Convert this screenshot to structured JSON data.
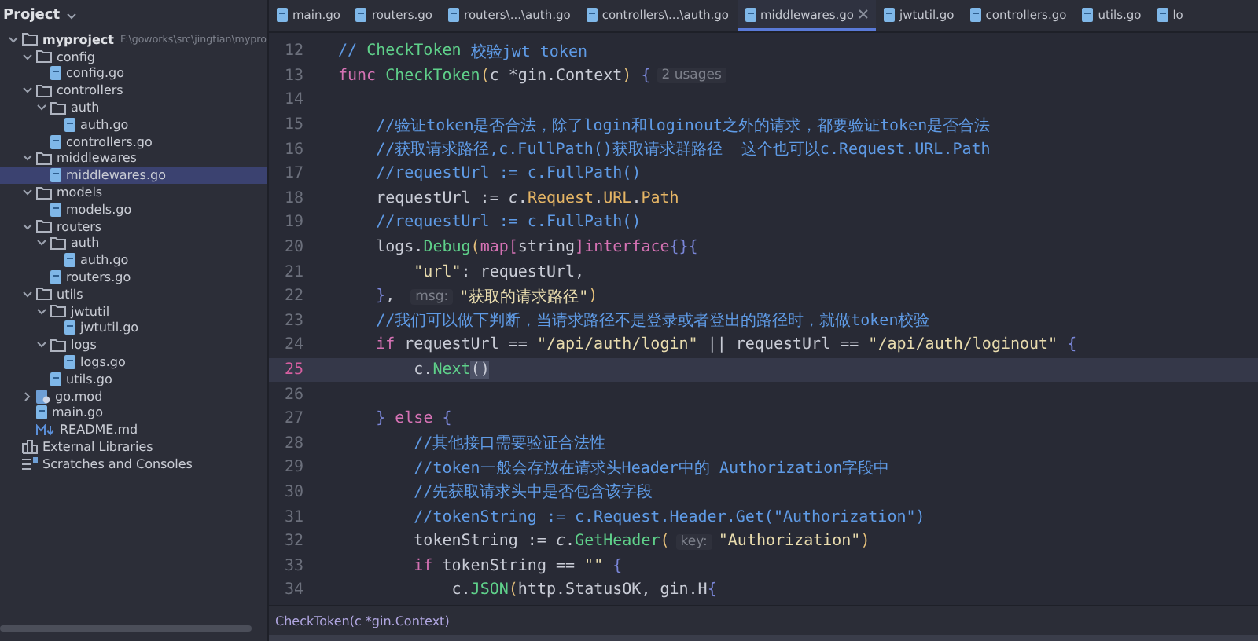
{
  "sidebar": {
    "title": "Project",
    "tree": [
      {
        "label": "myproject",
        "path": "F:\\goworks\\src\\jingtian\\mypro",
        "kind": "folder",
        "expanded": true,
        "selected": false,
        "children": [
          {
            "label": "config",
            "kind": "folder",
            "expanded": true,
            "selected": false,
            "children": [
              {
                "label": "config.go",
                "kind": "go",
                "selected": false
              }
            ]
          },
          {
            "label": "controllers",
            "kind": "folder",
            "expanded": true,
            "selected": false,
            "children": [
              {
                "label": "auth",
                "kind": "folder",
                "expanded": true,
                "selected": false,
                "children": [
                  {
                    "label": "auth.go",
                    "kind": "go",
                    "selected": false
                  }
                ]
              },
              {
                "label": "controllers.go",
                "kind": "go",
                "selected": false
              }
            ]
          },
          {
            "label": "middlewares",
            "kind": "folder",
            "expanded": true,
            "selected": false,
            "children": [
              {
                "label": "middlewares.go",
                "kind": "go",
                "selected": true
              }
            ]
          },
          {
            "label": "models",
            "kind": "folder",
            "expanded": true,
            "selected": false,
            "children": [
              {
                "label": "models.go",
                "kind": "go",
                "selected": false
              }
            ]
          },
          {
            "label": "routers",
            "kind": "folder",
            "expanded": true,
            "selected": false,
            "children": [
              {
                "label": "auth",
                "kind": "folder",
                "expanded": true,
                "selected": false,
                "children": [
                  {
                    "label": "auth.go",
                    "kind": "go",
                    "selected": false
                  }
                ]
              },
              {
                "label": "routers.go",
                "kind": "go",
                "selected": false
              }
            ]
          },
          {
            "label": "utils",
            "kind": "folder",
            "expanded": true,
            "selected": false,
            "children": [
              {
                "label": "jwtutil",
                "kind": "folder",
                "expanded": true,
                "selected": false,
                "children": [
                  {
                    "label": "jwtutil.go",
                    "kind": "go",
                    "selected": false
                  }
                ]
              },
              {
                "label": "logs",
                "kind": "folder",
                "expanded": true,
                "selected": false,
                "children": [
                  {
                    "label": "logs.go",
                    "kind": "go",
                    "selected": false
                  }
                ]
              },
              {
                "label": "utils.go",
                "kind": "go",
                "selected": false
              }
            ]
          },
          {
            "label": "go.mod",
            "kind": "mod",
            "expanded": false,
            "selected": false
          },
          {
            "label": "main.go",
            "kind": "go",
            "selected": false
          },
          {
            "label": "README.md",
            "kind": "md",
            "selected": false
          }
        ]
      },
      {
        "label": "External Libraries",
        "kind": "libraries",
        "selected": false
      },
      {
        "label": "Scratches and Consoles",
        "kind": "scratches",
        "selected": false
      }
    ]
  },
  "tabs": [
    {
      "label": "main.go",
      "selected": false
    },
    {
      "label": "routers.go",
      "selected": false
    },
    {
      "label": "routers\\...\\auth.go",
      "selected": false
    },
    {
      "label": "controllers\\...\\auth.go",
      "selected": false
    },
    {
      "label": "middlewares.go",
      "selected": true
    },
    {
      "label": "jwtutil.go",
      "selected": false
    },
    {
      "label": "controllers.go",
      "selected": false
    },
    {
      "label": "utils.go",
      "selected": false
    },
    {
      "label": "lo",
      "selected": false
    }
  ],
  "editor": {
    "lines": [
      {
        "number": "12",
        "current": false,
        "tokens": [
          {
            "kind": "comment",
            "text": "// "
          },
          {
            "kind": "commentref",
            "text": "CheckToken"
          },
          {
            "kind": "comment",
            "text": " 校验jwt token"
          }
        ]
      },
      {
        "number": "13",
        "current": false,
        "tokens": [
          {
            "kind": "keyword",
            "text": "func "
          },
          {
            "kind": "func",
            "text": "CheckToken"
          },
          {
            "kind": "paren",
            "text": "("
          },
          {
            "kind": "plain",
            "text": "c *gin.Context"
          },
          {
            "kind": "paren",
            "text": ")"
          },
          {
            "kind": "brace",
            "text": " {"
          },
          {
            "kind": "hint",
            "text": "2 usages"
          }
        ]
      },
      {
        "number": "14",
        "current": false
      },
      {
        "number": "15",
        "current": false,
        "tokens": [
          {
            "kind": "comment",
            "text": "    //验证token是否合法，除了login和loginout之外的请求，都要验证token是否合法"
          }
        ]
      },
      {
        "number": "16",
        "current": false,
        "tokens": [
          {
            "kind": "comment",
            "text": "    //获取请求路径,c.FullPath()获取请求群路径  这个也可以c.Request.URL.Path"
          }
        ]
      },
      {
        "number": "17",
        "current": false,
        "tokens": [
          {
            "kind": "comment",
            "text": "    //requestUrl := c.FullPath()"
          }
        ]
      },
      {
        "number": "18",
        "current": false,
        "tokens": [
          {
            "kind": "plain",
            "text": "    requestUrl := "
          },
          {
            "kind": "receiver",
            "text": "c"
          },
          {
            "kind": "plain",
            "text": "."
          },
          {
            "kind": "field",
            "text": "Request"
          },
          {
            "kind": "plain",
            "text": "."
          },
          {
            "kind": "field",
            "text": "URL"
          },
          {
            "kind": "plain",
            "text": "."
          },
          {
            "kind": "field",
            "text": "Path"
          }
        ]
      },
      {
        "number": "19",
        "current": false,
        "tokens": [
          {
            "kind": "comment",
            "text": "    //requestUrl := c.FullPath()"
          }
        ]
      },
      {
        "number": "20",
        "current": false,
        "tokens": [
          {
            "kind": "plain",
            "text": "    logs."
          },
          {
            "kind": "func",
            "text": "Debug"
          },
          {
            "kind": "paren",
            "text": "("
          },
          {
            "kind": "keyword",
            "text": "map"
          },
          {
            "kind": "bracket",
            "text": "["
          },
          {
            "kind": "plain",
            "text": "string"
          },
          {
            "kind": "bracket",
            "text": "]"
          },
          {
            "kind": "keyword",
            "text": "interface"
          },
          {
            "kind": "brace",
            "text": "{}{"
          }
        ]
      },
      {
        "number": "21",
        "current": false,
        "tokens": [
          {
            "kind": "string",
            "text": "        \"url\""
          },
          {
            "kind": "plain",
            "text": ": requestUrl,"
          }
        ]
      },
      {
        "number": "22",
        "current": false,
        "tokens": [
          {
            "kind": "brace",
            "text": "    }"
          },
          {
            "kind": "plain",
            "text": ", "
          },
          {
            "kind": "hint",
            "text": "msg:"
          },
          {
            "kind": "string",
            "text": "\"获取的请求路径\""
          },
          {
            "kind": "paren",
            "text": ")"
          }
        ]
      },
      {
        "number": "23",
        "current": false,
        "tokens": [
          {
            "kind": "comment",
            "text": "    //我们可以做下判断，当请求路径不是登录或者登出的路径时，就做token校验"
          }
        ]
      },
      {
        "number": "24",
        "current": false,
        "tokens": [
          {
            "kind": "keyword",
            "text": "    if"
          },
          {
            "kind": "plain",
            "text": " requestUrl == "
          },
          {
            "kind": "string",
            "text": "\"/api/auth/login\""
          },
          {
            "kind": "plain",
            "text": " || requestUrl == "
          },
          {
            "kind": "string",
            "text": "\"/api/auth/loginout\""
          },
          {
            "kind": "brace",
            "text": " {"
          }
        ]
      },
      {
        "number": "25",
        "current": true,
        "tokens": [
          {
            "kind": "plain",
            "text": "        c."
          },
          {
            "kind": "func",
            "text": "Next"
          },
          {
            "kind": "matched",
            "text": "()"
          }
        ]
      },
      {
        "number": "26",
        "current": false
      },
      {
        "number": "27",
        "current": false,
        "tokens": [
          {
            "kind": "brace",
            "text": "    }"
          },
          {
            "kind": "keyword",
            "text": " else "
          },
          {
            "kind": "brace",
            "text": "{"
          }
        ]
      },
      {
        "number": "28",
        "current": false,
        "tokens": [
          {
            "kind": "comment",
            "text": "        //其他接口需要验证合法性"
          }
        ]
      },
      {
        "number": "29",
        "current": false,
        "tokens": [
          {
            "kind": "comment",
            "text": "        //token一般会存放在请求头Header中的 Authorization字段中"
          }
        ]
      },
      {
        "number": "30",
        "current": false,
        "tokens": [
          {
            "kind": "comment",
            "text": "        //先获取请求头中是否包含该字段"
          }
        ]
      },
      {
        "number": "31",
        "current": false,
        "tokens": [
          {
            "kind": "comment",
            "text": "        //tokenString := c.Request.Header.Get(\"Authorization\")"
          }
        ]
      },
      {
        "number": "32",
        "current": false,
        "tokens": [
          {
            "kind": "plain",
            "text": "        tokenString := "
          },
          {
            "kind": "receiver",
            "text": "c"
          },
          {
            "kind": "plain",
            "text": "."
          },
          {
            "kind": "func",
            "text": "GetHeader"
          },
          {
            "kind": "paren",
            "text": "("
          },
          {
            "kind": "hint",
            "text": "key:"
          },
          {
            "kind": "string",
            "text": "\"Authorization\""
          },
          {
            "kind": "paren",
            "text": ")"
          }
        ]
      },
      {
        "number": "33",
        "current": false,
        "tokens": [
          {
            "kind": "keyword",
            "text": "        if"
          },
          {
            "kind": "plain",
            "text": " tokenString == "
          },
          {
            "kind": "string",
            "text": "\"\""
          },
          {
            "kind": "brace",
            "text": " {"
          }
        ]
      },
      {
        "number": "34",
        "current": false,
        "tokens": [
          {
            "kind": "plain",
            "text": "            c."
          },
          {
            "kind": "func",
            "text": "JSON"
          },
          {
            "kind": "paren",
            "text": "("
          },
          {
            "kind": "plain",
            "text": "http.StatusOK, gin.H"
          },
          {
            "kind": "brace",
            "text": "{"
          }
        ]
      }
    ]
  },
  "breadcrumb": "CheckToken(c *gin.Context)"
}
